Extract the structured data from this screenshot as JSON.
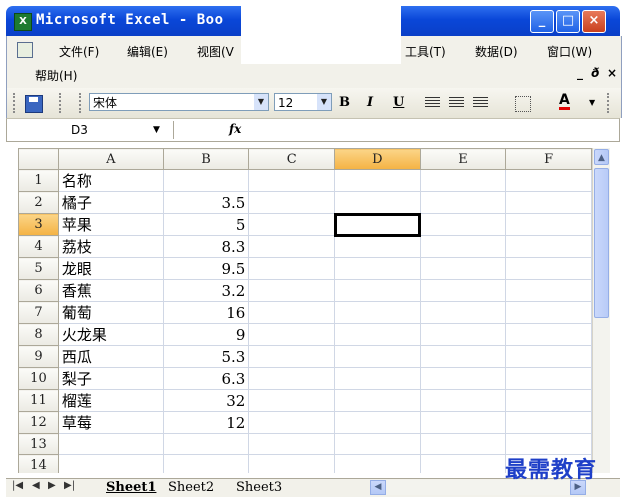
{
  "title_bar": {
    "title": "Microsoft Excel - Boo",
    "minimize": "_",
    "restore": "□",
    "close": "×"
  },
  "menu": {
    "items": [
      "文件(F)",
      "编辑(E)",
      "视图(V",
      "工具(T)",
      "数据(D)",
      "窗口(W)"
    ],
    "help": "帮助(H)",
    "mdi_minimize": "_",
    "mdi_restore": "ð",
    "mdi_close": "×"
  },
  "toolbar": {
    "font_name": "宋体",
    "font_size": "12",
    "bold": "B",
    "italic": "I",
    "underline": "U",
    "font_color": "A"
  },
  "formula_bar": {
    "name_box": "D3",
    "fx": "fx",
    "content": ""
  },
  "sheet": {
    "columns": [
      "A",
      "B",
      "C",
      "D",
      "E",
      "F"
    ],
    "active_column": "D",
    "active_row": "3",
    "rows": [
      {
        "n": "1",
        "a": "名称",
        "b": ""
      },
      {
        "n": "2",
        "a": "橘子",
        "b": "3.5"
      },
      {
        "n": "3",
        "a": "苹果",
        "b": "5"
      },
      {
        "n": "4",
        "a": "荔枝",
        "b": "8.3"
      },
      {
        "n": "5",
        "a": "龙眼",
        "b": "9.5"
      },
      {
        "n": "6",
        "a": "香蕉",
        "b": "3.2"
      },
      {
        "n": "7",
        "a": "葡萄",
        "b": "16"
      },
      {
        "n": "8",
        "a": "火龙果",
        "b": "9"
      },
      {
        "n": "9",
        "a": "西瓜",
        "b": "5.3"
      },
      {
        "n": "10",
        "a": "梨子",
        "b": "6.3"
      },
      {
        "n": "11",
        "a": "榴莲",
        "b": "32"
      },
      {
        "n": "12",
        "a": "草莓",
        "b": "12"
      },
      {
        "n": "13",
        "a": "",
        "b": ""
      },
      {
        "n": "14",
        "a": "",
        "b": ""
      }
    ]
  },
  "tabs": {
    "sheets": [
      "Sheet1",
      "Sheet2",
      "Sheet3"
    ],
    "active": "Sheet1"
  },
  "watermark": "最需教育"
}
